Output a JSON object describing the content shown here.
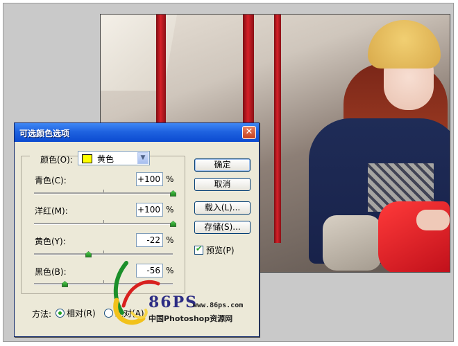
{
  "dialog": {
    "title": "可选颜色选项",
    "close_glyph": "✕",
    "color": {
      "label": "颜色(O):",
      "value": "黄色",
      "swatch_color": "#ffff00",
      "arrow": "▼"
    },
    "sliders": [
      {
        "label": "青色(C):",
        "value": "+100",
        "unit": "%",
        "level_fraction": 1.0
      },
      {
        "label": "洋红(M):",
        "value": "+100",
        "unit": "%",
        "level_fraction": 1.0
      },
      {
        "label": "黄色(Y):",
        "value": "-22",
        "unit": "%",
        "level_fraction": 0.39
      },
      {
        "label": "黑色(B):",
        "value": "-56",
        "unit": "%",
        "level_fraction": 0.22
      }
    ],
    "buttons": {
      "ok": "确定",
      "cancel": "取消",
      "load": "载入(L)...",
      "save": "存储(S)..."
    },
    "preview": {
      "label": "预览(P)",
      "checked": true,
      "check_glyph": "✔"
    },
    "method": {
      "label": "方法:",
      "options": [
        {
          "label": "相对(R)",
          "selected": true
        },
        {
          "label": "绝对(A)",
          "selected": false
        }
      ]
    }
  },
  "watermark": {
    "logo_text": "86PS",
    "url": "www.86ps.com",
    "site_name": "中国Photoshop资源网"
  },
  "colors": {
    "title_bar": "#0b4ad0",
    "dialog_bg": "#ece9d8",
    "thumb": "#21a121"
  }
}
